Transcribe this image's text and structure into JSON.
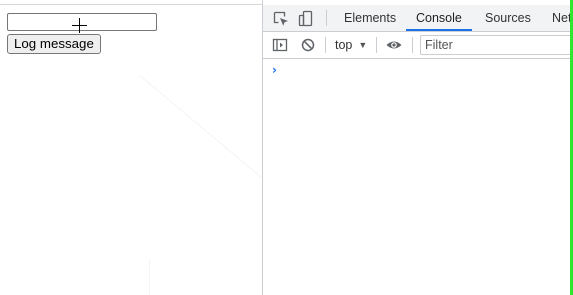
{
  "page": {
    "input_value": "",
    "log_button_label": "Log message"
  },
  "devtools": {
    "toolbar_icons": [
      "inspect-element-icon",
      "device-toolbar-icon"
    ],
    "tabs": [
      {
        "label": "Elements",
        "active": false
      },
      {
        "label": "Console",
        "active": true
      },
      {
        "label": "Sources",
        "active": false
      },
      {
        "label": "Net",
        "active": false
      }
    ],
    "console_toolbar": {
      "icons": [
        "sidebar-toggle-icon",
        "clear-console-icon",
        "eye-icon"
      ],
      "context": "top",
      "filter_placeholder": "Filter"
    },
    "prompt": "›"
  },
  "colors": {
    "active_tab_underline": "#1a73e8",
    "prompt": "#1a73e8",
    "window_edge": "#2ee82e"
  }
}
